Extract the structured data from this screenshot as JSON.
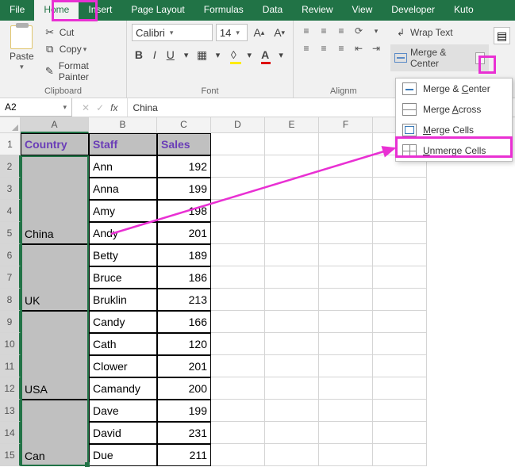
{
  "tabs": [
    "File",
    "Home",
    "Insert",
    "Page Layout",
    "Formulas",
    "Data",
    "Review",
    "View",
    "Developer",
    "Kuto"
  ],
  "active_tab_index": 1,
  "clipboard": {
    "paste": "Paste",
    "cut": "Cut",
    "copy": "Copy",
    "format_painter": "Format Painter",
    "group_label": "Clipboard"
  },
  "font": {
    "name": "Calibri",
    "size": "14",
    "group_label": "Font"
  },
  "alignment": {
    "wrap_text": "Wrap Text",
    "merge_center": "Merge & Center",
    "group_label": "Alignm"
  },
  "merge_menu": {
    "items": [
      "Merge & Center",
      "Merge Across",
      "Merge Cells",
      "Unmerge Cells"
    ]
  },
  "name_box": "A2",
  "formula_value": "China",
  "columns": [
    "A",
    "B",
    "C",
    "D",
    "E",
    "F",
    "G"
  ],
  "rows_count": 15,
  "headers": {
    "country": "Country",
    "staff": "Staff",
    "sales": "Sales"
  },
  "merged_a": [
    {
      "rows": 4,
      "label": "China"
    },
    {
      "rows": 3,
      "label": "UK"
    },
    {
      "rows": 4,
      "label": "USA"
    },
    {
      "rows": 3,
      "label": "Can"
    }
  ],
  "staff_sales": [
    {
      "staff": "Ann",
      "sales": 192
    },
    {
      "staff": "Anna",
      "sales": 199
    },
    {
      "staff": "Amy",
      "sales": 198
    },
    {
      "staff": "Andy",
      "sales": 201
    },
    {
      "staff": "Betty",
      "sales": 189
    },
    {
      "staff": "Bruce",
      "sales": 186
    },
    {
      "staff": "Bruklin",
      "sales": 213
    },
    {
      "staff": "Candy",
      "sales": 166
    },
    {
      "staff": "Cath",
      "sales": 120
    },
    {
      "staff": "Clower",
      "sales": 201
    },
    {
      "staff": "Camandy",
      "sales": 200
    },
    {
      "staff": "Dave",
      "sales": 199
    },
    {
      "staff": "David",
      "sales": 231
    },
    {
      "staff": "Due",
      "sales": 211
    }
  ]
}
